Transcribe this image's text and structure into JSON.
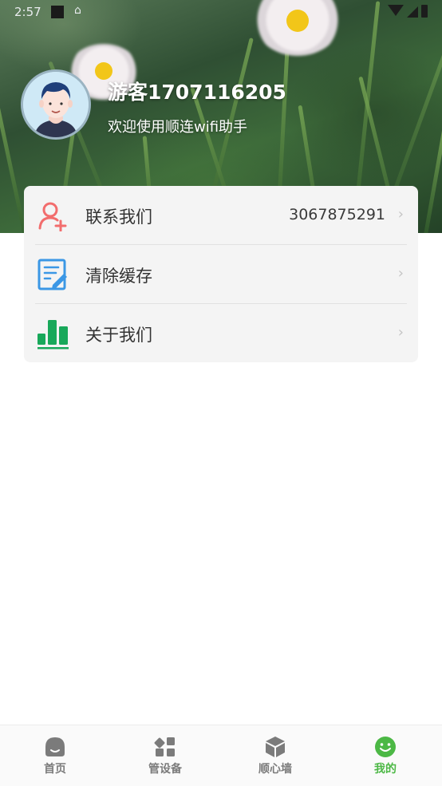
{
  "status_bar": {
    "time": "2:57"
  },
  "profile": {
    "username": "游客1707116205",
    "welcome": "欢迎使用顺连wifi助手"
  },
  "menu": {
    "items": [
      {
        "label": "联系我们",
        "value": "3067875291",
        "icon": "add-contact-icon",
        "icon_color": "#f26d6d"
      },
      {
        "label": "清除缓存",
        "value": "",
        "icon": "edit-document-icon",
        "icon_color": "#3b97e5"
      },
      {
        "label": "关于我们",
        "value": "",
        "icon": "bar-chart-icon",
        "icon_color": "#18a85a"
      }
    ]
  },
  "bottom_nav": {
    "active_color": "#4cb845",
    "inactive_color": "#7b7b7b",
    "tabs": [
      {
        "label": "首页",
        "icon": "home-icon",
        "active": false
      },
      {
        "label": "管设备",
        "icon": "devices-icon",
        "active": false
      },
      {
        "label": "顺心墙",
        "icon": "box-icon",
        "active": false
      },
      {
        "label": "我的",
        "icon": "smiley-icon",
        "active": true
      }
    ]
  }
}
